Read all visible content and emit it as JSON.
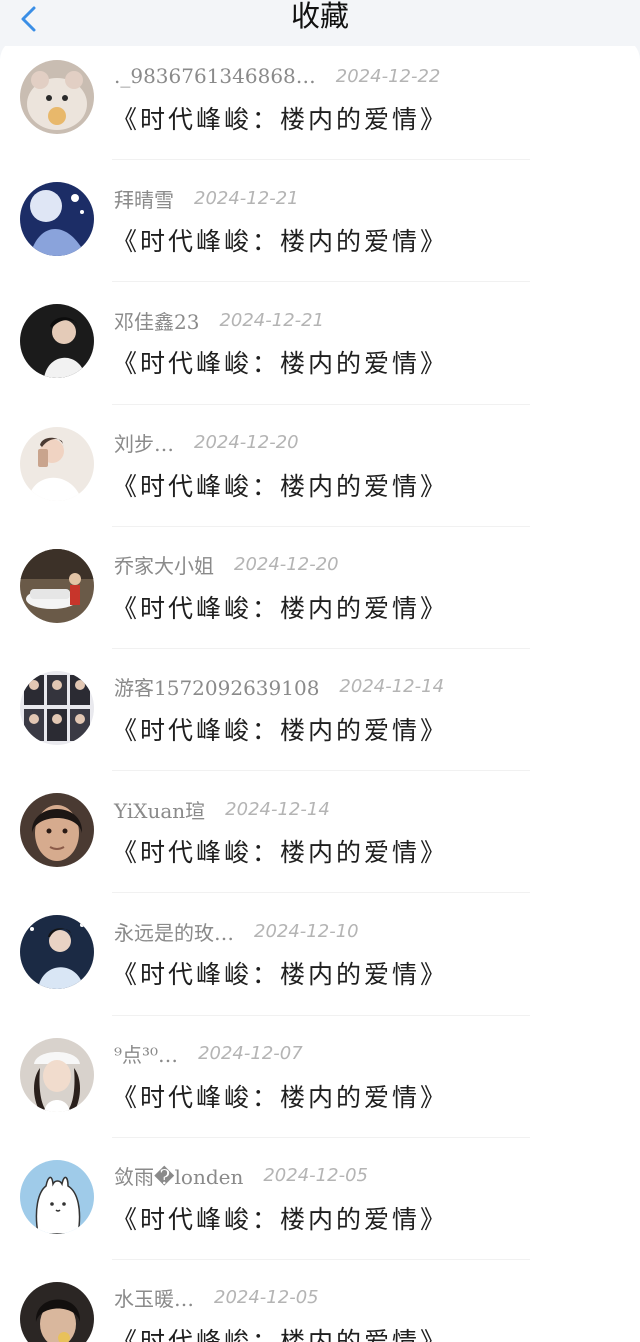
{
  "header": {
    "title": "收藏",
    "back_icon": "chevron-left-icon",
    "accent_color": "#3a8ee6"
  },
  "favorites": [
    {
      "user": "._9836761346868…",
      "date": "2024-12-22",
      "work": "《时代峰峻：楼内的爱情》"
    },
    {
      "user": "拜晴雪",
      "date": "2024-12-21",
      "work": "《时代峰峻：楼内的爱情》"
    },
    {
      "user": "邓佳鑫23",
      "date": "2024-12-21",
      "work": "《时代峰峻：楼内的爱情》"
    },
    {
      "user": "刘步…",
      "date": "2024-12-20",
      "work": "《时代峰峻：楼内的爱情》"
    },
    {
      "user": "乔家大小姐",
      "date": "2024-12-20",
      "work": "《时代峰峻：楼内的爱情》"
    },
    {
      "user": "游客1572092639108",
      "date": "2024-12-14",
      "work": "《时代峰峻：楼内的爱情》"
    },
    {
      "user": "YiXuan瑄",
      "date": "2024-12-14",
      "work": "《时代峰峻：楼内的爱情》"
    },
    {
      "user": "永远是的玫…",
      "date": "2024-12-10",
      "work": "《时代峰峻：楼内的爱情》"
    },
    {
      "user": "⁹点³⁰…",
      "date": "2024-12-07",
      "work": "《时代峰峻：楼内的爱情》"
    },
    {
      "user": "敛雨�londen",
      "date": "2024-12-05",
      "work": "《时代峰峻：楼内的爱情》"
    },
    {
      "user": "水玉暖…",
      "date": "2024-12-05",
      "work": "《时代峰峻：楼内的爱情》"
    }
  ]
}
